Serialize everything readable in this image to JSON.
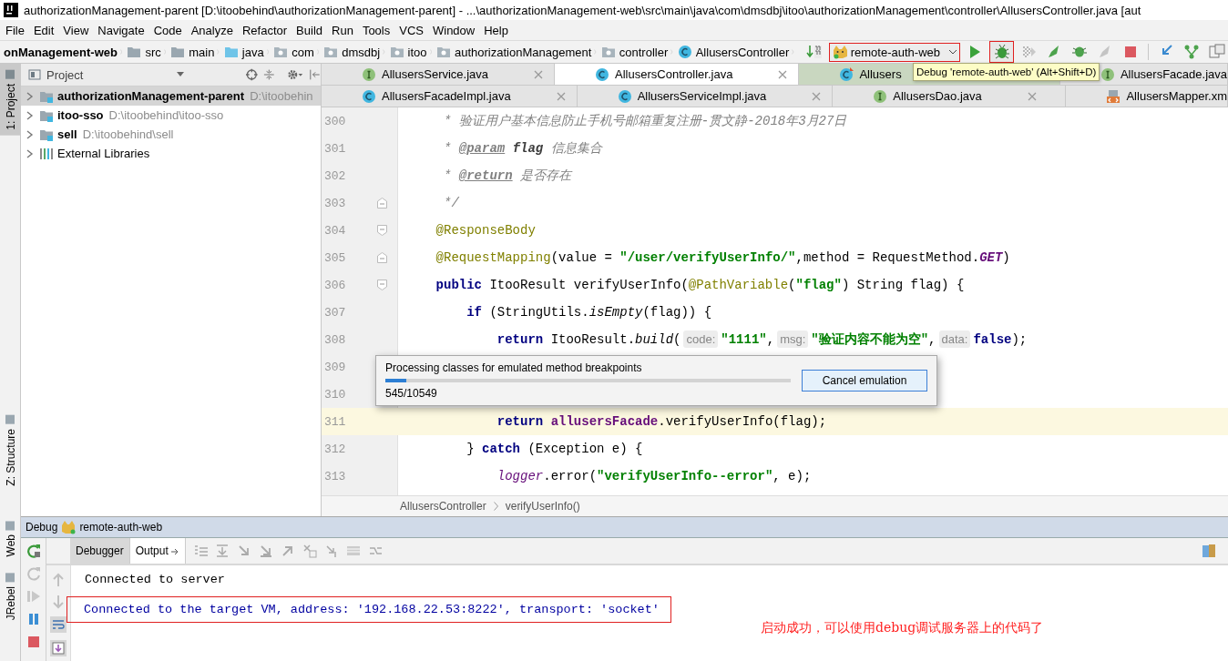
{
  "window": {
    "title": "authorizationManagement-parent [D:\\itoobehind\\authorizationManagement-parent] - ...\\authorizationManagement-web\\src\\main\\java\\com\\dmsdbj\\itoo\\authorizationManagement\\controller\\AllusersController.java [aut"
  },
  "menu": [
    "File",
    "Edit",
    "View",
    "Navigate",
    "Code",
    "Analyze",
    "Refactor",
    "Build",
    "Run",
    "Tools",
    "VCS",
    "Window",
    "Help"
  ],
  "breadcrumbs": [
    {
      "label": "onManagement-web",
      "kind": "module"
    },
    {
      "label": "src",
      "kind": "folder"
    },
    {
      "label": "main",
      "kind": "folder"
    },
    {
      "label": "java",
      "kind": "source"
    },
    {
      "label": "com",
      "kind": "package"
    },
    {
      "label": "dmsdbj",
      "kind": "package"
    },
    {
      "label": "itoo",
      "kind": "package"
    },
    {
      "label": "authorizationManagement",
      "kind": "package"
    },
    {
      "label": "controller",
      "kind": "package"
    },
    {
      "label": "AllusersController",
      "kind": "class"
    }
  ],
  "run_config": {
    "label": "remote-auth-web"
  },
  "tooltip": "Debug 'remote-auth-web' (Alt+Shift+D)",
  "side_tabs": [
    {
      "label": "1: Project",
      "selected": true
    },
    {
      "label": "Z: Structure",
      "selected": false
    },
    {
      "label": "Web",
      "selected": false
    },
    {
      "label": "JRebel",
      "selected": false
    }
  ],
  "project": {
    "title": "Project",
    "tree": [
      {
        "name": "authorizationManagement-parent",
        "path": "D:\\itoobehin",
        "kind": "module",
        "selected": true
      },
      {
        "name": "itoo-sso",
        "path": "D:\\itoobehind\\itoo-sso",
        "kind": "module",
        "selected": false
      },
      {
        "name": "sell",
        "path": "D:\\itoobehind\\sell",
        "kind": "module",
        "selected": false
      },
      {
        "name": "External Libraries",
        "kind": "library",
        "selected": false
      }
    ]
  },
  "editor_tabs": [
    [
      {
        "label": "AllusersService.java",
        "kind": "interface",
        "selected": false
      },
      {
        "label": "AllusersController.java",
        "kind": "class",
        "selected": true
      },
      {
        "label": "Allusers",
        "kind": "class-changed",
        "selected": false
      },
      {
        "label": "AllusersFacade.java",
        "kind": "interface",
        "selected": false
      }
    ],
    [
      {
        "label": "AllusersFacadeImpl.java",
        "kind": "class",
        "selected": false
      },
      {
        "label": "AllusersServiceImpl.java",
        "kind": "class",
        "selected": false
      },
      {
        "label": "AllusersDao.java",
        "kind": "interface",
        "selected": false
      },
      {
        "label": "AllusersMapper.xm",
        "kind": "xml",
        "selected": false
      }
    ]
  ],
  "code": [
    {
      "number": "300",
      "highlighted": false,
      "segments": [
        {
          "text": "     * 验证用户基本信息防止手机号邮箱重复注册-贯文静-2018年3月27日",
          "kind": "comment"
        }
      ]
    },
    {
      "number": "301",
      "highlighted": false,
      "segments": [
        {
          "text": "     * ",
          "kind": "comment"
        },
        {
          "text": "@param",
          "kind": "doc-tag"
        },
        {
          "text": " flag",
          "kind": "doc-name"
        },
        {
          "text": " 信息集合",
          "kind": "comment"
        }
      ]
    },
    {
      "number": "302",
      "highlighted": false,
      "segments": [
        {
          "text": "     * ",
          "kind": "comment"
        },
        {
          "text": "@return",
          "kind": "doc-tag"
        },
        {
          "text": " 是否存在",
          "kind": "comment"
        }
      ]
    },
    {
      "number": "303",
      "highlighted": false,
      "segments": [
        {
          "text": "     */",
          "kind": "comment"
        }
      ]
    },
    {
      "number": "304",
      "highlighted": false,
      "segments": [
        {
          "text": "    @ResponseBody",
          "kind": "annotation"
        }
      ]
    },
    {
      "number": "305",
      "highlighted": false,
      "segments": [
        {
          "text": "    @RequestMapping",
          "kind": "annotation"
        },
        {
          "text": "(value = ",
          "kind": "plain"
        },
        {
          "text": "\"/user/verifyUserInfo/\"",
          "kind": "string"
        },
        {
          "text": ",method = RequestMethod.",
          "kind": "plain"
        },
        {
          "text": "GET",
          "kind": "constant"
        },
        {
          "text": ")",
          "kind": "plain"
        }
      ]
    },
    {
      "number": "306",
      "highlighted": false,
      "segments": [
        {
          "text": "    public",
          "kind": "keyword"
        },
        {
          "text": " ItooResult verifyUserInfo(",
          "kind": "plain"
        },
        {
          "text": "@PathVariable",
          "kind": "annotation"
        },
        {
          "text": "(",
          "kind": "plain"
        },
        {
          "text": "\"flag\"",
          "kind": "string"
        },
        {
          "text": ") String flag) {",
          "kind": "plain"
        }
      ]
    },
    {
      "number": "307",
      "highlighted": false,
      "segments": [
        {
          "text": "        if",
          "kind": "keyword"
        },
        {
          "text": " (StringUtils.",
          "kind": "plain"
        },
        {
          "text": "isEmpty",
          "kind": "static"
        },
        {
          "text": "(flag)) {",
          "kind": "plain"
        }
      ]
    },
    {
      "number": "308",
      "highlighted": false,
      "segments": [
        {
          "text": "            return",
          "kind": "keyword"
        },
        {
          "text": " ItooResult.",
          "kind": "plain"
        },
        {
          "text": "build",
          "kind": "static"
        },
        {
          "text": "(",
          "kind": "plain"
        },
        {
          "text": "code:",
          "kind": "hint"
        },
        {
          "text": "\"1111\"",
          "kind": "string"
        },
        {
          "text": ",",
          "kind": "plain"
        },
        {
          "text": "msg:",
          "kind": "hint"
        },
        {
          "text": "\"验证内容不能为空\"",
          "kind": "string"
        },
        {
          "text": ",",
          "kind": "plain"
        },
        {
          "text": "data:",
          "kind": "hint"
        },
        {
          "text": "false",
          "kind": "keyword"
        },
        {
          "text": ");",
          "kind": "plain"
        }
      ]
    },
    {
      "number": "309",
      "highlighted": false
    },
    {
      "number": "310",
      "highlighted": false
    },
    {
      "number": "311",
      "highlighted": true,
      "segments": [
        {
          "text": "            return",
          "kind": "keyword"
        },
        {
          "text": " allusersFacade",
          "kind": "field"
        },
        {
          "text": ".verifyUserInfo(flag);",
          "kind": "plain"
        }
      ]
    },
    {
      "number": "312",
      "highlighted": false,
      "segments": [
        {
          "text": "        } ",
          "kind": "plain"
        },
        {
          "text": "catch",
          "kind": "keyword"
        },
        {
          "text": " (Exception e) {",
          "kind": "plain"
        }
      ]
    },
    {
      "number": "313",
      "highlighted": false,
      "segments": [
        {
          "text": "            logger",
          "kind": "static-field"
        },
        {
          "text": ".error(",
          "kind": "plain"
        },
        {
          "text": "\"verifyUserInfo--error\"",
          "kind": "string"
        },
        {
          "text": ", e);",
          "kind": "plain"
        }
      ]
    }
  ],
  "code_breadcrumbs": [
    "AllusersController",
    "verifyUserInfo()"
  ],
  "dialog": {
    "message": "Processing classes for emulated method breakpoints",
    "level": 0.052,
    "count": "545/10549",
    "button": "Cancel emulation"
  },
  "debug": {
    "title": "Debug",
    "config": "remote-auth-web",
    "tabs": [
      {
        "label": "Debugger",
        "selected": false
      },
      {
        "label": "Output",
        "selected": true
      }
    ],
    "output": [
      {
        "text": "Connected to server",
        "kind": "info"
      },
      {
        "text": "Connected to the target VM, address: '192.168.22.53:8222', transport: 'socket'",
        "kind": "system"
      }
    ]
  },
  "annotation": "启动成功，可以使用debug调试服务器上的代码了"
}
